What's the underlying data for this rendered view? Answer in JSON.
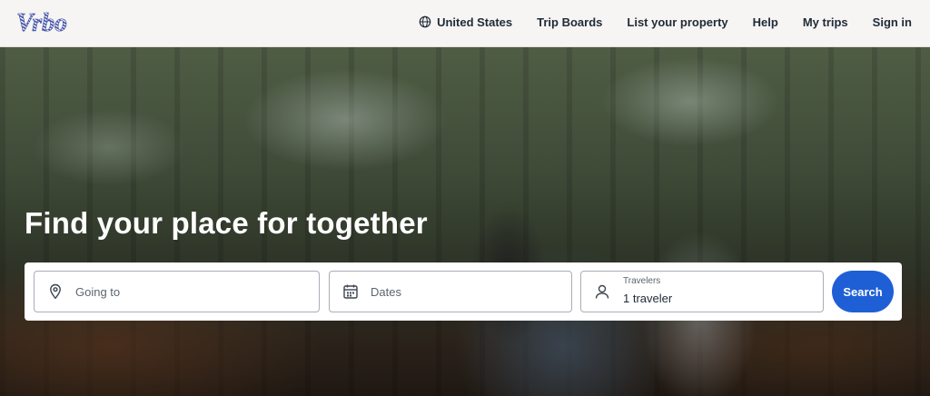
{
  "header": {
    "logo_text": "Vrbo",
    "nav": [
      {
        "label": "United States",
        "icon": "globe-icon"
      },
      {
        "label": "Trip Boards"
      },
      {
        "label": "List your property"
      },
      {
        "label": "Help"
      },
      {
        "label": "My trips"
      },
      {
        "label": "Sign in"
      }
    ]
  },
  "hero": {
    "title": "Find your place for together",
    "search": {
      "going_to_placeholder": "Going to",
      "dates_placeholder": "Dates",
      "travelers_label": "Travelers",
      "travelers_value": "1 traveler",
      "search_button": "Search"
    }
  },
  "colors": {
    "brand": "#3d4fa8",
    "search_button": "#1f5fd6",
    "header_bg": "#f6f5f3"
  }
}
